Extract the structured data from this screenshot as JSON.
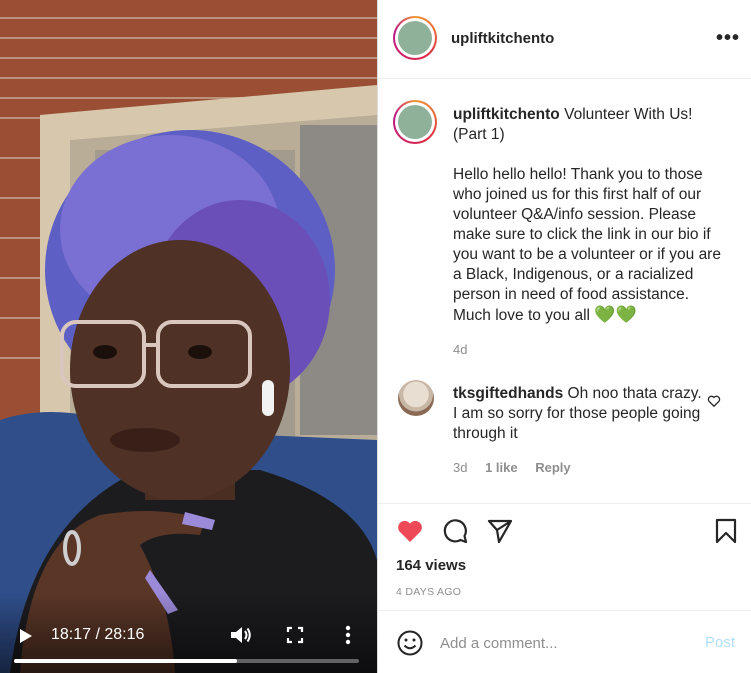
{
  "video": {
    "time_display": "18:17 / 28:16",
    "progress_fraction": 0.645,
    "icons": {
      "play": "play-icon",
      "volume": "volume-icon",
      "fullscreen": "fullscreen-icon",
      "more": "more-vertical-icon"
    }
  },
  "header": {
    "username": "upliftkitchento",
    "more_label": "•••"
  },
  "caption": {
    "username": "upliftkitchento",
    "title": "Volunteer With Us! (Part 1)",
    "body": "Hello hello hello! Thank you to those who joined us for this first half of our volunteer Q&A/info session. Please make sure to click the link in our bio if you want to be a volunteer or if you are a Black, Indigenous, or a racialized person in need of food assistance. Much love to you all",
    "emoji": "💚💚",
    "time": "4d"
  },
  "comment": {
    "username": "tksgiftedhands",
    "text": "Oh noo thata crazy. I am so sorry for those people going through it",
    "time": "3d",
    "likes": "1 like",
    "reply_label": "Reply"
  },
  "stats": {
    "views": "164 views",
    "posted": "4 DAYS AGO"
  },
  "add_comment": {
    "placeholder": "Add a comment...",
    "post_label": "Post"
  },
  "colors": {
    "like_red": "#ed4956",
    "muted": "#8e8e8e",
    "post_disabled": "#b2dffc",
    "emoji_green": "#2db335"
  }
}
